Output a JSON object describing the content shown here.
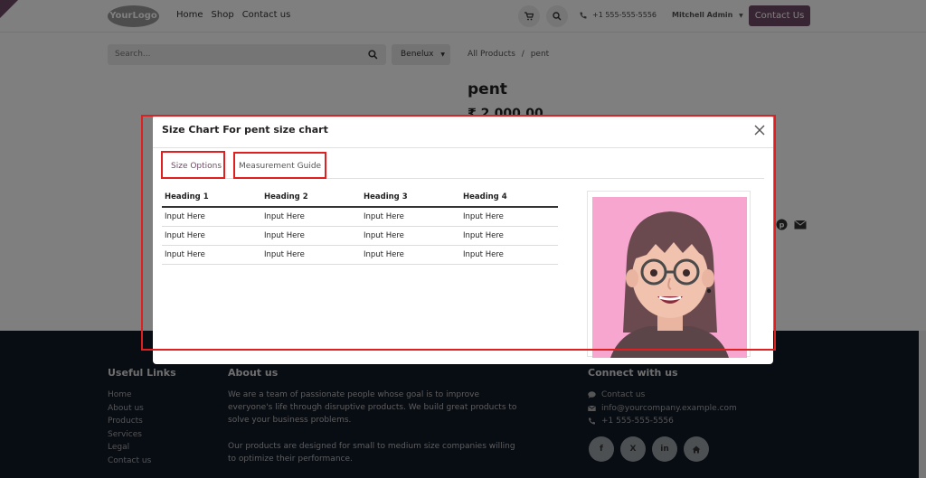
{
  "header": {
    "logo_text": "YourLogo",
    "nav": [
      "Home",
      "Shop",
      "Contact us"
    ],
    "phone": "+1 555-555-5556",
    "user": "Mitchell Admin",
    "contact_button": "Contact Us"
  },
  "shop": {
    "search_placeholder": "Search...",
    "pricelist": "Benelux",
    "breadcrumb": {
      "parent": "All Products",
      "separator": "/",
      "current": "pent"
    },
    "product_title": "pent",
    "price_peek": "₹ 2,000.00"
  },
  "modal": {
    "title": "Size Chart For pent size chart",
    "tabs": [
      "Size Options",
      "Measurement Guide"
    ],
    "table": {
      "headers": [
        "Heading 1",
        "Heading 2",
        "Heading 3",
        "Heading 4"
      ],
      "rows": [
        [
          "Input Here",
          "Input Here",
          "Input Here",
          "Input Here"
        ],
        [
          "Input Here",
          "Input Here",
          "Input Here",
          "Input Here"
        ],
        [
          "Input Here",
          "Input Here",
          "Input Here",
          "Input Here"
        ]
      ]
    }
  },
  "footer": {
    "useful_links_title": "Useful Links",
    "useful_links": [
      "Home",
      "About us",
      "Products",
      "Services",
      "Legal",
      "Contact us"
    ],
    "about_title": "About us",
    "about_p1": "We are a team of passionate people whose goal is to improve everyone's life through disruptive products. We build great products to solve your business problems.",
    "about_p2": "Our products are designed for small to medium size companies willing to optimize their performance.",
    "connect_title": "Connect with us",
    "connect": {
      "contact": "Contact us",
      "email": "info@yourcompany.example.com",
      "phone": "+1 555-555-5556"
    },
    "social": [
      "f",
      "X",
      "in",
      "home"
    ]
  },
  "colors": {
    "brand": "#714b67",
    "highlight": "#e02020",
    "footer_bg": "#111827",
    "avatar_bg": "#f6a6cf"
  }
}
